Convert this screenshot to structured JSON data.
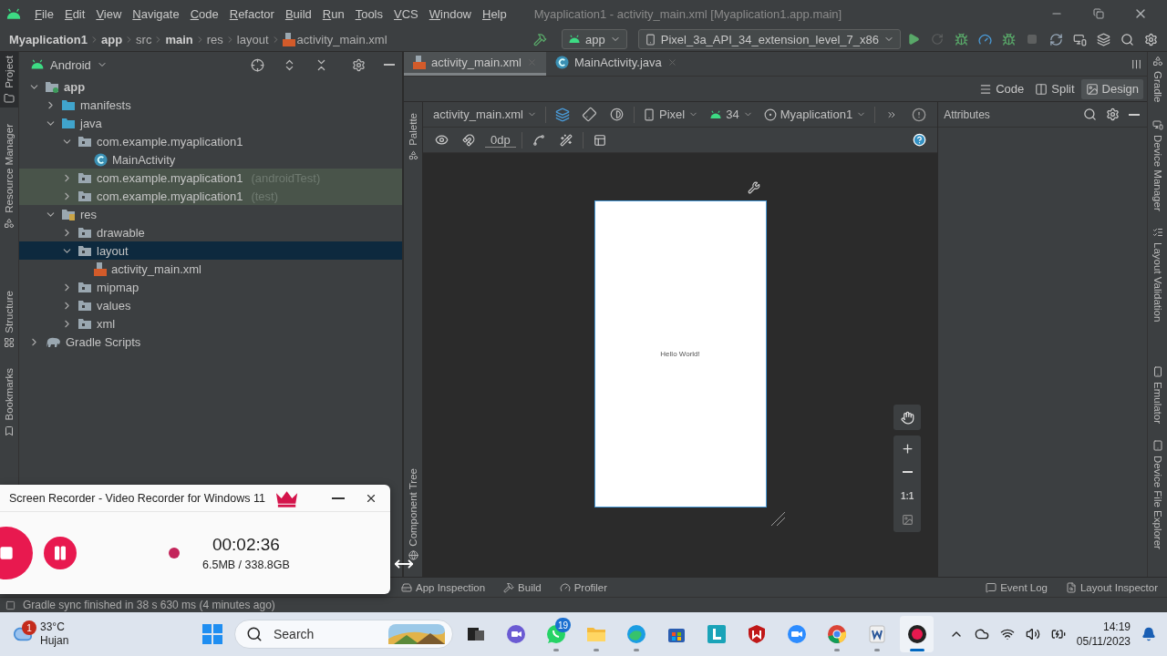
{
  "menu_bar": {
    "items": [
      "File",
      "Edit",
      "View",
      "Navigate",
      "Code",
      "Refactor",
      "Build",
      "Run",
      "Tools",
      "VCS",
      "Window",
      "Help"
    ],
    "title": "Myaplication1 - activity_main.xml [Myaplication1.app.main]"
  },
  "navigation_bar": {
    "breadcrumbs": [
      {
        "label": "Myaplication1",
        "bold": true
      },
      {
        "label": "app",
        "bold": true
      },
      {
        "label": "src",
        "bold": false
      },
      {
        "label": "main",
        "bold": true
      },
      {
        "label": "res",
        "bold": false
      },
      {
        "label": "layout",
        "bold": false
      },
      {
        "label": "activity_main.xml",
        "bold": false
      }
    ],
    "run_configuration": "app",
    "device": "Pixel_3a_API_34_extension_level_7_x86"
  },
  "left_tool_strip": [
    {
      "label": "Project",
      "kind": "project",
      "selected": true
    },
    {
      "label": "Resource Manager",
      "kind": "resources",
      "selected": false
    },
    {
      "label": "Structure",
      "kind": "structure",
      "selected": false
    },
    {
      "label": "Bookmarks",
      "kind": "bookmarks",
      "selected": false
    }
  ],
  "project_panel": {
    "view": "Android",
    "tree": [
      {
        "label": "app",
        "kind": "module",
        "expanded": true,
        "selected": false,
        "highlighted": false,
        "children": [
          {
            "label": "manifests",
            "kind": "source",
            "expanded": false,
            "selected": false,
            "highlighted": false
          },
          {
            "label": "java",
            "kind": "source",
            "expanded": true,
            "selected": false,
            "highlighted": false,
            "children": [
              {
                "label": "com.example.myaplication1",
                "kind": "package",
                "expanded": true,
                "selected": false,
                "highlighted": false,
                "children": [
                  {
                    "label": "MainActivity",
                    "kind": "class",
                    "selected": false,
                    "highlighted": false
                  }
                ]
              },
              {
                "label": "com.example.myaplication1",
                "suffix": "(androidTest)",
                "kind": "package",
                "expanded": false,
                "selected": false,
                "highlighted": true
              },
              {
                "label": "com.example.myaplication1",
                "suffix": "(test)",
                "kind": "package",
                "expanded": false,
                "selected": false,
                "highlighted": true
              }
            ]
          },
          {
            "label": "res",
            "kind": "resources",
            "expanded": true,
            "selected": false,
            "highlighted": false,
            "children": [
              {
                "label": "drawable",
                "kind": "package",
                "expanded": false,
                "selected": false,
                "highlighted": false
              },
              {
                "label": "layout",
                "kind": "package",
                "expanded": true,
                "selected": true,
                "highlighted": false,
                "children": [
                  {
                    "label": "activity_main.xml",
                    "kind": "layout_file",
                    "selected": false,
                    "highlighted": false
                  }
                ]
              },
              {
                "label": "mipmap",
                "kind": "package",
                "expanded": false,
                "selected": false,
                "highlighted": false
              },
              {
                "label": "values",
                "kind": "package",
                "expanded": false,
                "selected": false,
                "highlighted": false
              },
              {
                "label": "xml",
                "kind": "package",
                "expanded": false,
                "selected": false,
                "highlighted": false
              }
            ]
          }
        ]
      },
      {
        "label": "Gradle Scripts",
        "kind": "gradle",
        "expanded": false,
        "selected": false,
        "highlighted": false
      }
    ]
  },
  "editor": {
    "tabs": [
      {
        "label": "activity_main.xml",
        "kind": "xml",
        "selected": true
      },
      {
        "label": "MainActivity.java",
        "kind": "java",
        "selected": false
      }
    ],
    "view_modes": [
      {
        "label": "Code",
        "kind": "code",
        "selected": false
      },
      {
        "label": "Split",
        "kind": "split",
        "selected": false
      },
      {
        "label": "Design",
        "kind": "design",
        "selected": true
      }
    ],
    "side_tools": [
      {
        "label": "Palette",
        "kind": "palette"
      },
      {
        "label": "Component Tree",
        "kind": "tree"
      }
    ],
    "design_toolbar": {
      "file": "activity_main.xml",
      "device": "Pixel",
      "api_level": "34",
      "theme": "Myaplication1",
      "default_margin": "0dp"
    },
    "preview": {
      "text": "Hello World!"
    },
    "zoom_controls": {
      "actual_size": "1:1"
    },
    "attributes": {
      "title": "Attributes"
    }
  },
  "right_tool_strip": [
    {
      "label": "Gradle",
      "kind": "gradle"
    },
    {
      "label": "Device Manager",
      "kind": "device"
    },
    {
      "label": "Layout Validation",
      "kind": "validation"
    },
    {
      "label": "Emulator",
      "kind": "emulator"
    },
    {
      "label": "Device File Explorer",
      "kind": "files"
    }
  ],
  "bottom_tools": {
    "left": [
      {
        "label": "App Inspection",
        "kind": "inspection"
      },
      {
        "label": "Build",
        "kind": "build"
      },
      {
        "label": "Profiler",
        "kind": "profiler"
      }
    ],
    "right": [
      {
        "label": "Event Log",
        "kind": "event_log"
      },
      {
        "label": "Layout Inspector",
        "kind": "layout_inspector"
      }
    ]
  },
  "status_bar": {
    "message": "Gradle sync finished in 38 s 630 ms (4 minutes ago)"
  },
  "screen_recorder": {
    "title": "Screen Recorder - Video Recorder for Windows 11",
    "elapsed": "00:02:36",
    "size": "6.5MB / 338.8GB"
  },
  "taskbar": {
    "weather": {
      "badge": "1",
      "temperature": "33°C",
      "condition": "Hujan"
    },
    "search": {
      "placeholder": "Search"
    },
    "apps": [
      {
        "kind": "task_view",
        "running": false,
        "selected": false
      },
      {
        "kind": "meet",
        "running": false,
        "selected": false
      },
      {
        "kind": "whatsapp",
        "badge": "19",
        "running": true,
        "selected": false
      },
      {
        "kind": "explorer",
        "running": true,
        "selected": false
      },
      {
        "kind": "edge",
        "running": true,
        "selected": false
      },
      {
        "kind": "store",
        "running": false,
        "selected": false
      },
      {
        "kind": "l_app",
        "running": false,
        "selected": false
      },
      {
        "kind": "mcafee",
        "running": false,
        "selected": false
      },
      {
        "kind": "zoom",
        "running": false,
        "selected": false
      },
      {
        "kind": "chrome",
        "running": true,
        "selected": false
      },
      {
        "kind": "word",
        "running": true,
        "selected": false
      },
      {
        "kind": "recorder",
        "running": true,
        "selected": true
      }
    ],
    "clock": {
      "time": "14:19",
      "date": "05/11/2023"
    }
  }
}
